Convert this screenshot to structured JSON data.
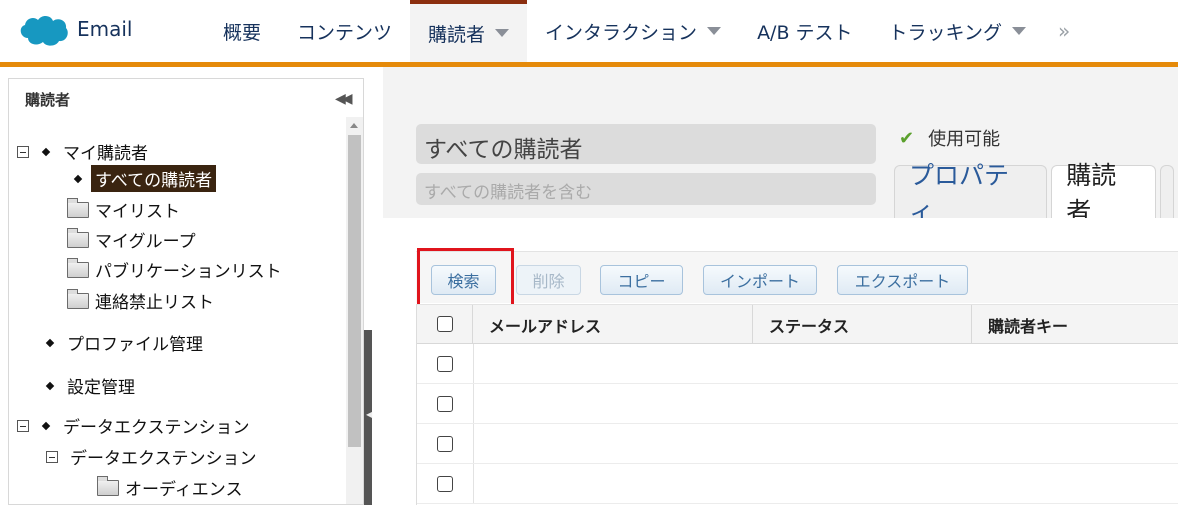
{
  "app": {
    "name": "Email"
  },
  "nav": {
    "items": [
      {
        "label": "概要",
        "has_caret": false,
        "active": false
      },
      {
        "label": "コンテンツ",
        "has_caret": false,
        "active": false
      },
      {
        "label": "購読者",
        "has_caret": true,
        "active": true
      },
      {
        "label": "インタラクション",
        "has_caret": true,
        "active": false
      },
      {
        "label": "A/B テスト",
        "has_caret": false,
        "active": false
      },
      {
        "label": "トラッキング",
        "has_caret": true,
        "active": false
      }
    ],
    "more": "»"
  },
  "sidebar": {
    "title": "購読者",
    "tree": [
      {
        "label": "マイ購読者"
      },
      {
        "label": "すべての購読者"
      },
      {
        "label": "マイリスト"
      },
      {
        "label": "マイグループ"
      },
      {
        "label": "パブリケーションリスト"
      },
      {
        "label": "連絡禁止リスト"
      },
      {
        "label": "プロファイル管理"
      },
      {
        "label": "設定管理"
      },
      {
        "label": "データエクステンション"
      },
      {
        "label": "データエクステンション"
      },
      {
        "label": "オーディエンス"
      }
    ]
  },
  "detail": {
    "name": "すべての購読者",
    "description_placeholder": "すべての購読者を含む",
    "status": "使用可能",
    "tabs": [
      {
        "label": "プロパティ"
      },
      {
        "label": "購読者"
      }
    ]
  },
  "toolbar": {
    "search": "検索",
    "delete": "削除",
    "copy": "コピー",
    "import": "インポート",
    "export": "エクスポート"
  },
  "table": {
    "columns": [
      "メールアドレス",
      "ステータス",
      "購読者キー"
    ],
    "row_count": 4
  },
  "colors": {
    "accent": "#e58a0a",
    "highlight": "#e0141c",
    "selected_bg": "#3a2410"
  }
}
